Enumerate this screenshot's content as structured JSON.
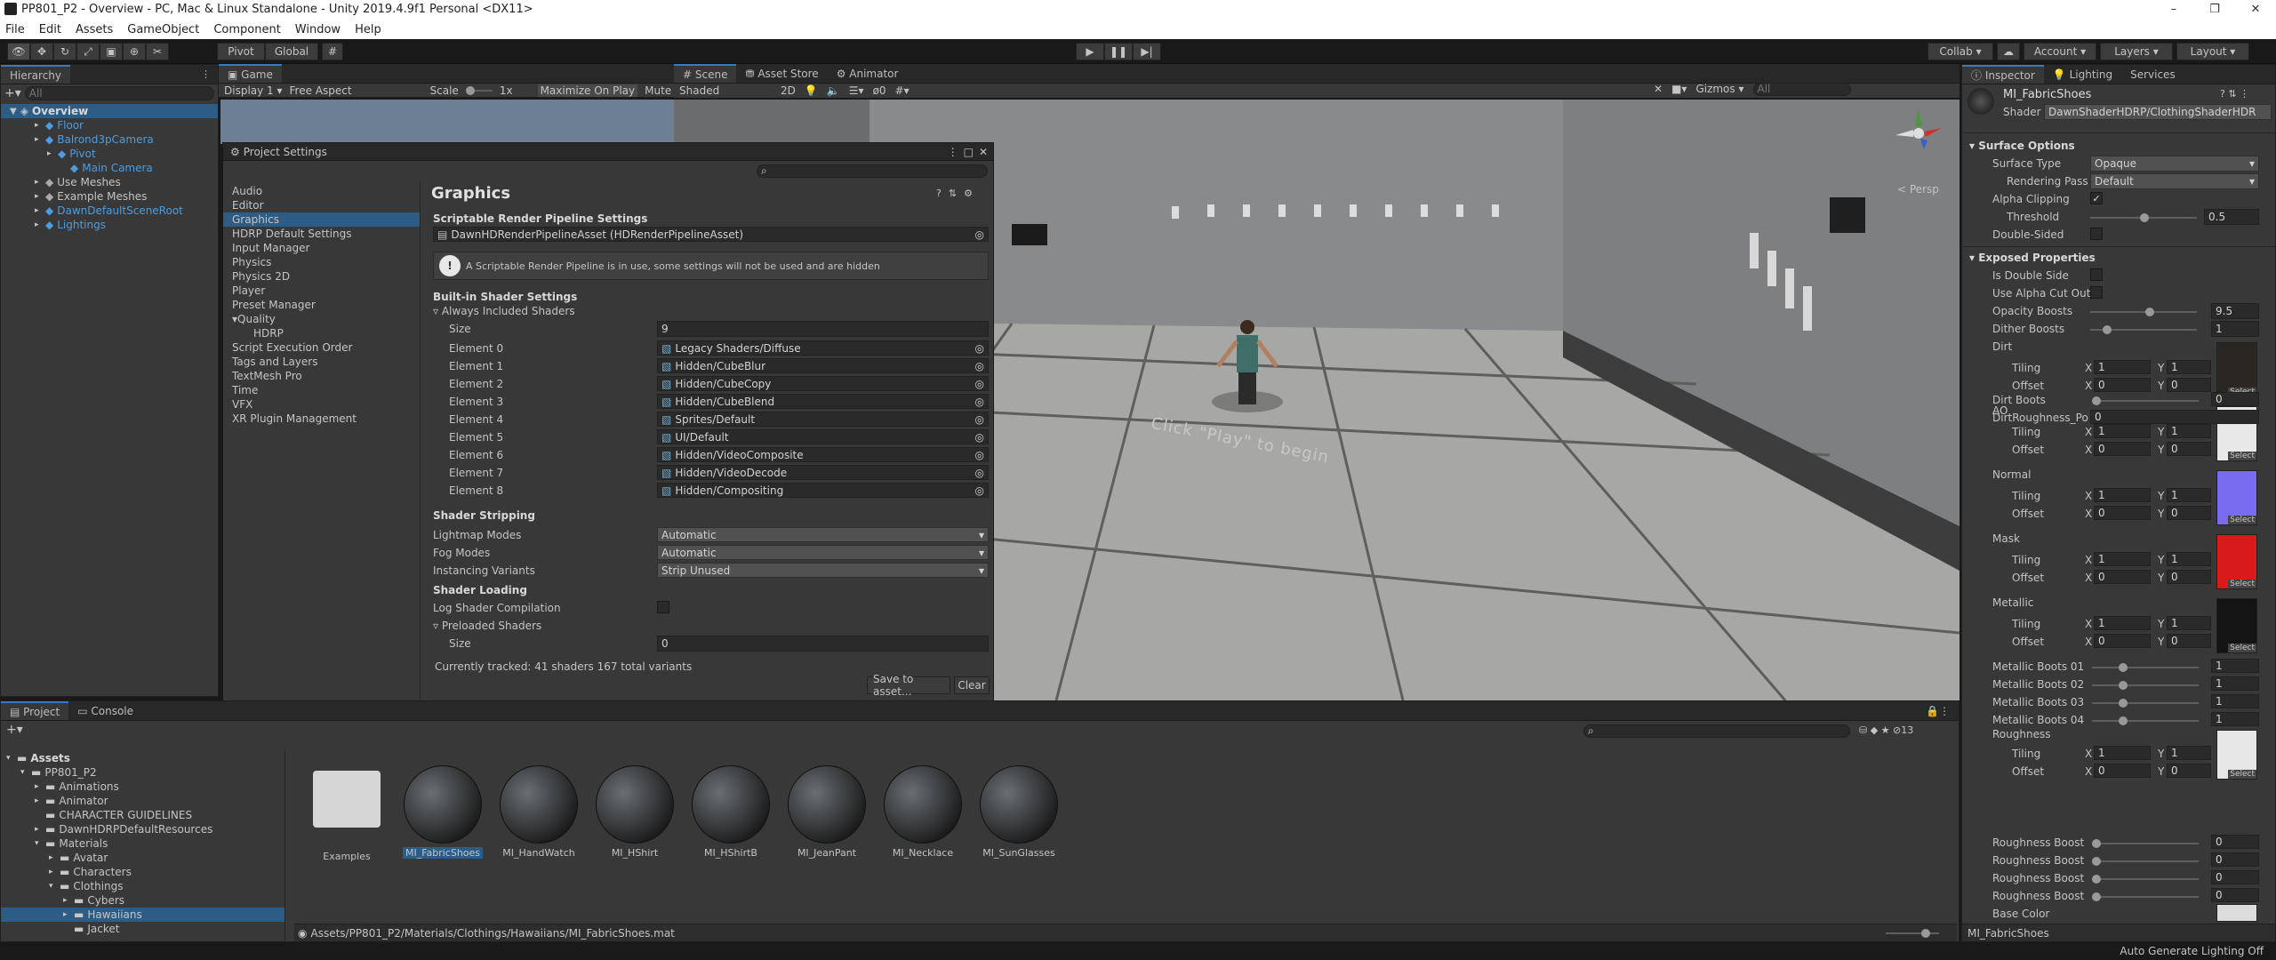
{
  "window": {
    "title": "PP801_P2 - Overview - PC, Mac & Linux Standalone - Unity 2019.4.9f1 Personal <DX11>",
    "controls": [
      "–",
      "❐",
      "✕"
    ]
  },
  "menu": [
    "File",
    "Edit",
    "Assets",
    "GameObject",
    "Component",
    "Window",
    "Help"
  ],
  "toolbar": {
    "pivot": "Pivot",
    "global": "Global",
    "collab": "Collab ▾",
    "account": "Account",
    "layers": "Layers",
    "layout": "Layout"
  },
  "hierarchy": {
    "tab": "Hierarchy",
    "search_placeholder": "All",
    "scene": "Overview",
    "items": [
      {
        "label": "Floor",
        "indent": 1,
        "blue": true
      },
      {
        "label": "Balrond3pCamera",
        "indent": 1,
        "blue": true
      },
      {
        "label": "Pivot",
        "indent": 2,
        "blue": true
      },
      {
        "label": "Main Camera",
        "indent": 3,
        "blue": true
      },
      {
        "label": "Use Meshes",
        "indent": 1,
        "blue": false
      },
      {
        "label": "Example Meshes",
        "indent": 1,
        "blue": false
      },
      {
        "label": "DawnDefaultSceneRoot",
        "indent": 1,
        "blue": true
      },
      {
        "label": "Lightings",
        "indent": 1,
        "blue": true
      }
    ]
  },
  "game": {
    "tab": "Game",
    "display": "Display 1",
    "aspect": "Free Aspect",
    "scale_label": "Scale",
    "scale_value": "1x",
    "maximize": "Maximize On Play",
    "mute": "Mute"
  },
  "scene_tabs": [
    "Scene",
    "Asset Store",
    "Animator"
  ],
  "scene_toolbar": {
    "shading": "Shaded",
    "mode2d": "2D",
    "gizmos": "Gizmos",
    "search_placeholder": "All",
    "fx_count": "0",
    "persp": "< Persp"
  },
  "scene_overlay_text": "Click \"Play\" to begin",
  "project_settings": {
    "title": "Project Settings",
    "nav": [
      "Audio",
      "Editor",
      "Graphics",
      "HDRP Default Settings",
      "Input Manager",
      "Physics",
      "Physics 2D",
      "Player",
      "Preset Manager",
      "Quality",
      "HDRP",
      "Script Execution Order",
      "Tags and Layers",
      "TextMesh Pro",
      "Time",
      "VFX",
      "XR Plugin Management"
    ],
    "heading": "Graphics",
    "srp_section": "Scriptable Render Pipeline Settings",
    "srp_asset": "DawnHDRenderPipelineAsset (HDRenderPipelineAsset)",
    "srp_warning": "A Scriptable Render Pipeline is in use, some settings will not be used and are hidden",
    "builtin_section": "Built-in Shader Settings",
    "always_included": "Always Included Shaders",
    "size_label": "Size",
    "size_value": "9",
    "elements": [
      {
        "label": "Element 0",
        "value": "Legacy Shaders/Diffuse"
      },
      {
        "label": "Element 1",
        "value": "Hidden/CubeBlur"
      },
      {
        "label": "Element 2",
        "value": "Hidden/CubeCopy"
      },
      {
        "label": "Element 3",
        "value": "Hidden/CubeBlend"
      },
      {
        "label": "Element 4",
        "value": "Sprites/Default"
      },
      {
        "label": "Element 5",
        "value": "UI/Default"
      },
      {
        "label": "Element 6",
        "value": "Hidden/VideoComposite"
      },
      {
        "label": "Element 7",
        "value": "Hidden/VideoDecode"
      },
      {
        "label": "Element 8",
        "value": "Hidden/Compositing"
      }
    ],
    "stripping_section": "Shader Stripping",
    "stripping": [
      {
        "label": "Lightmap Modes",
        "value": "Automatic"
      },
      {
        "label": "Fog Modes",
        "value": "Automatic"
      },
      {
        "label": "Instancing Variants",
        "value": "Strip Unused"
      }
    ],
    "loading_section": "Shader Loading",
    "log_compilation": "Log Shader Compilation",
    "preloaded": "Preloaded Shaders",
    "preloaded_size_label": "Size",
    "preloaded_size_value": "0",
    "tracked": "Currently tracked: 41 shaders 167 total variants",
    "save_btn": "Save to asset...",
    "clear_btn": "Clear"
  },
  "project": {
    "tabs": [
      "Project",
      "Console"
    ],
    "tree": [
      {
        "label": "Assets",
        "indent": 0,
        "bold": true
      },
      {
        "label": "PP801_P2",
        "indent": 1
      },
      {
        "label": "Animations",
        "indent": 2
      },
      {
        "label": "Animator",
        "indent": 2
      },
      {
        "label": "CHARACTER GUIDELINES",
        "indent": 2
      },
      {
        "label": "DawnHDRPDefaultResources",
        "indent": 2
      },
      {
        "label": "Materials",
        "indent": 2
      },
      {
        "label": "Avatar",
        "indent": 3
      },
      {
        "label": "Characters",
        "indent": 3
      },
      {
        "label": "Clothings",
        "indent": 3
      },
      {
        "label": "Cybers",
        "indent": 4
      },
      {
        "label": "Hawaiians",
        "indent": 4,
        "selected": true
      },
      {
        "label": "Jacket",
        "indent": 4
      }
    ],
    "assets": [
      "Examples",
      "MI_FabricShoes",
      "MI_HandWatch",
      "MI_HShirt",
      "MI_HShirtB",
      "MI_JeanPant",
      "MI_Necklace",
      "MI_SunGlasses"
    ],
    "path": "Assets/PP801_P2/Materials/Clothings/Hawaiians/MI_FabricShoes.mat",
    "count": "13"
  },
  "inspector": {
    "tabs": [
      "Inspector",
      "Lighting",
      "Services"
    ],
    "material": "MI_FabricShoes",
    "shader_label": "Shader",
    "shader_value": "DawnShaderHDRP/ClothingShaderHDR",
    "surface_section": "Surface Options",
    "surface_type_label": "Surface Type",
    "surface_type": "Opaque",
    "rendering_pass_label": "Rendering Pass",
    "rendering_pass": "Default",
    "alpha_clipping": "Alpha Clipping",
    "threshold_label": "Threshold",
    "threshold": "0.5",
    "double_sided": "Double-Sided",
    "exposed_section": "Exposed Properties",
    "is_double_side": "Is Double Side",
    "use_alpha_cutout": "Use Alpha Cut Out",
    "opacity_label": "Opacity Boosts",
    "opacity": "9.5",
    "dither_label": "Dither Boosts",
    "dither": "1",
    "textures": [
      {
        "name": "Dirt",
        "tx": "1",
        "ty": "1",
        "ox": "0",
        "oy": "0",
        "color": "#2a2622"
      },
      {
        "name": "AO",
        "tx": "1",
        "ty": "1",
        "ox": "0",
        "oy": "0",
        "color": "#e8e8e8"
      },
      {
        "name": "Normal",
        "tx": "1",
        "ty": "1",
        "ox": "0",
        "oy": "0",
        "color": "#7a6cf0"
      },
      {
        "name": "Mask",
        "tx": "1",
        "ty": "1",
        "ox": "0",
        "oy": "0",
        "color": "#d91a1a"
      },
      {
        "name": "Metallic",
        "tx": "1",
        "ty": "1",
        "ox": "0",
        "oy": "0",
        "color": "#141414"
      }
    ],
    "tiling_label": "Tiling",
    "offset_label": "Offset",
    "x_label": "X",
    "y_label": "Y",
    "select_label": "Select",
    "dirt_boots_label": "Dirt Boots",
    "dirt_boots": "0",
    "dirt_roughness_label": "DirtRoughness_Po",
    "dirt_roughness": "0",
    "metallic_boots": [
      {
        "label": "Metallic Boots 01",
        "value": "1"
      },
      {
        "label": "Metallic Boots 02",
        "value": "1"
      },
      {
        "label": "Metallic Boots 03",
        "value": "1"
      },
      {
        "label": "Metallic Boots 04",
        "value": "1"
      }
    ],
    "roughness_label": "Roughness",
    "roughness_tx": "1",
    "roughness_ty": "1",
    "roughness_ox": "0",
    "roughness_oy": "0",
    "roughness_boosts": [
      {
        "label": "Roughness Boost (",
        "value": "0"
      },
      {
        "label": "Roughness Boost (",
        "value": "0"
      },
      {
        "label": "Roughness Boost (",
        "value": "0"
      },
      {
        "label": "Roughness Boost (",
        "value": "0"
      }
    ],
    "base_color": "Base Color",
    "footer": "MI_FabricShoes"
  },
  "status": "Auto Generate Lighting Off"
}
